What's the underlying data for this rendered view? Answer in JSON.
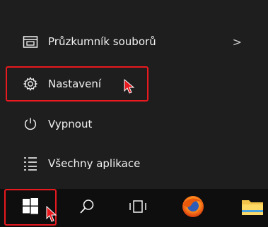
{
  "start_menu": {
    "items": [
      {
        "label": "Průzkumník souborů",
        "icon": "file-explorer-icon",
        "has_submenu": true
      },
      {
        "label": "Nastavení",
        "icon": "gear-icon",
        "highlighted": true
      },
      {
        "label": "Vypnout",
        "icon": "power-icon"
      },
      {
        "label": "Všechny aplikace",
        "icon": "all-apps-icon"
      }
    ],
    "submenu_chevron": ">"
  },
  "taskbar": {
    "buttons": [
      {
        "name": "start",
        "icon": "windows-logo-icon",
        "highlighted": true
      },
      {
        "name": "search",
        "icon": "search-icon"
      },
      {
        "name": "task-view",
        "icon": "task-view-icon"
      },
      {
        "name": "firefox",
        "icon": "firefox-icon"
      },
      {
        "name": "file-explorer",
        "icon": "folder-icon"
      }
    ]
  },
  "colors": {
    "highlight": "#e8191f",
    "menu_bg": "#1e1e1e",
    "taskbar_bg": "#0e0e0e",
    "text": "#f2f2f2"
  }
}
